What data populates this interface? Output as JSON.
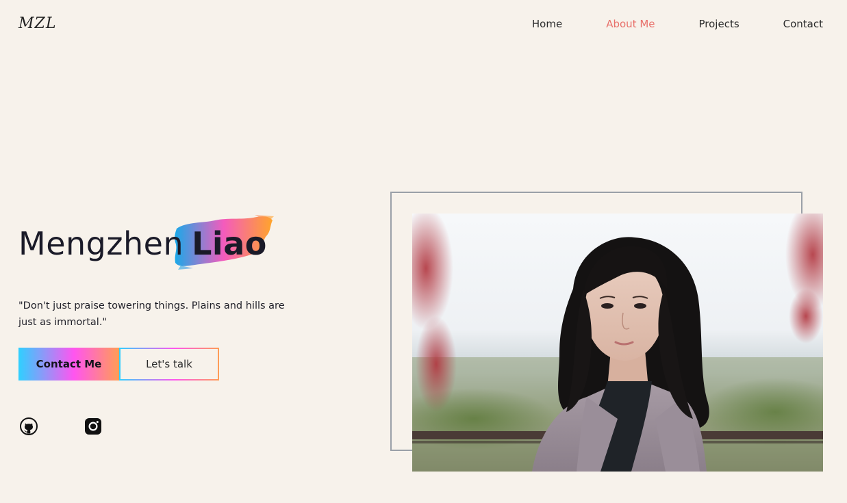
{
  "header": {
    "logo": "MZL",
    "nav": [
      {
        "label": "Home",
        "active": false
      },
      {
        "label": "About Me",
        "active": true
      },
      {
        "label": "Projects",
        "active": false
      },
      {
        "label": "Contact",
        "active": false
      }
    ]
  },
  "hero": {
    "first_name": "Mengzhen",
    "last_name": "Liao",
    "quote": "\"Don't just praise towering things. Plains and hills are just as immortal.\"",
    "primary_button": "Contact Me",
    "secondary_button": "Let's talk",
    "social": [
      {
        "icon": "github-icon"
      },
      {
        "icon": "instagram-icon"
      }
    ]
  },
  "colors": {
    "background": "#f7f2eb",
    "accent": "#e8706a",
    "gradient": [
      "#2fd0ff",
      "#ff55f0",
      "#ff9d55"
    ],
    "frame": "#9aa0a8"
  }
}
